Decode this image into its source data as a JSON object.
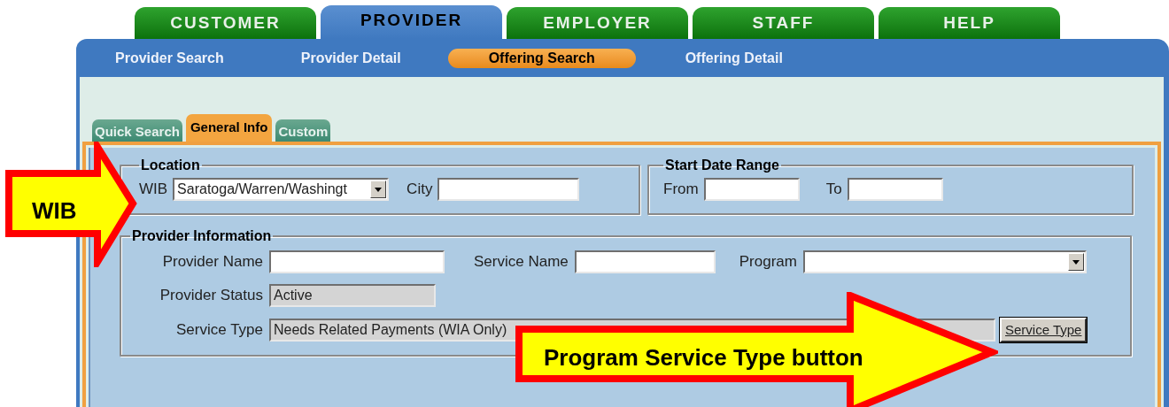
{
  "main_tabs": [
    {
      "label": "CUSTOMER",
      "selected": false
    },
    {
      "label": "PROVIDER",
      "selected": true
    },
    {
      "label": "EMPLOYER",
      "selected": false
    },
    {
      "label": "STAFF",
      "selected": false
    },
    {
      "label": "HELP",
      "selected": false
    }
  ],
  "sub_nav": [
    {
      "label": "Provider Search",
      "selected": false
    },
    {
      "label": "Provider Detail",
      "selected": false
    },
    {
      "label": "Offering Search",
      "selected": true
    },
    {
      "label": "Offering Detail",
      "selected": false
    }
  ],
  "form_tabs": [
    {
      "label": "Quick Search",
      "selected": false
    },
    {
      "label": "General Info",
      "selected": true
    },
    {
      "label": "Custom",
      "selected": false
    }
  ],
  "location": {
    "legend": "Location",
    "fields": [
      {
        "kind": "select",
        "label": "WIB",
        "value": "Saratoga/Warren/Washingt"
      },
      {
        "kind": "text",
        "label": "City"
      }
    ]
  },
  "start_date_range": {
    "legend": "Start Date Range",
    "fields": [
      {
        "kind": "text",
        "label": "From"
      },
      {
        "kind": "text",
        "label": "To"
      }
    ]
  },
  "provider_information": {
    "legend": "Provider Information",
    "provider_name": {
      "label": "Provider Name"
    },
    "service_name": {
      "label": "Service Name"
    },
    "program": {
      "label": "Program"
    },
    "provider_status": {
      "label": "Provider Status",
      "value": "Active"
    },
    "service_type": {
      "label": "Service Type",
      "value": "Needs Related Payments (WIA Only)",
      "button": "Service Type"
    }
  },
  "callouts": [
    {
      "text": "WIB"
    },
    {
      "text": "Program Service Type button"
    }
  ]
}
